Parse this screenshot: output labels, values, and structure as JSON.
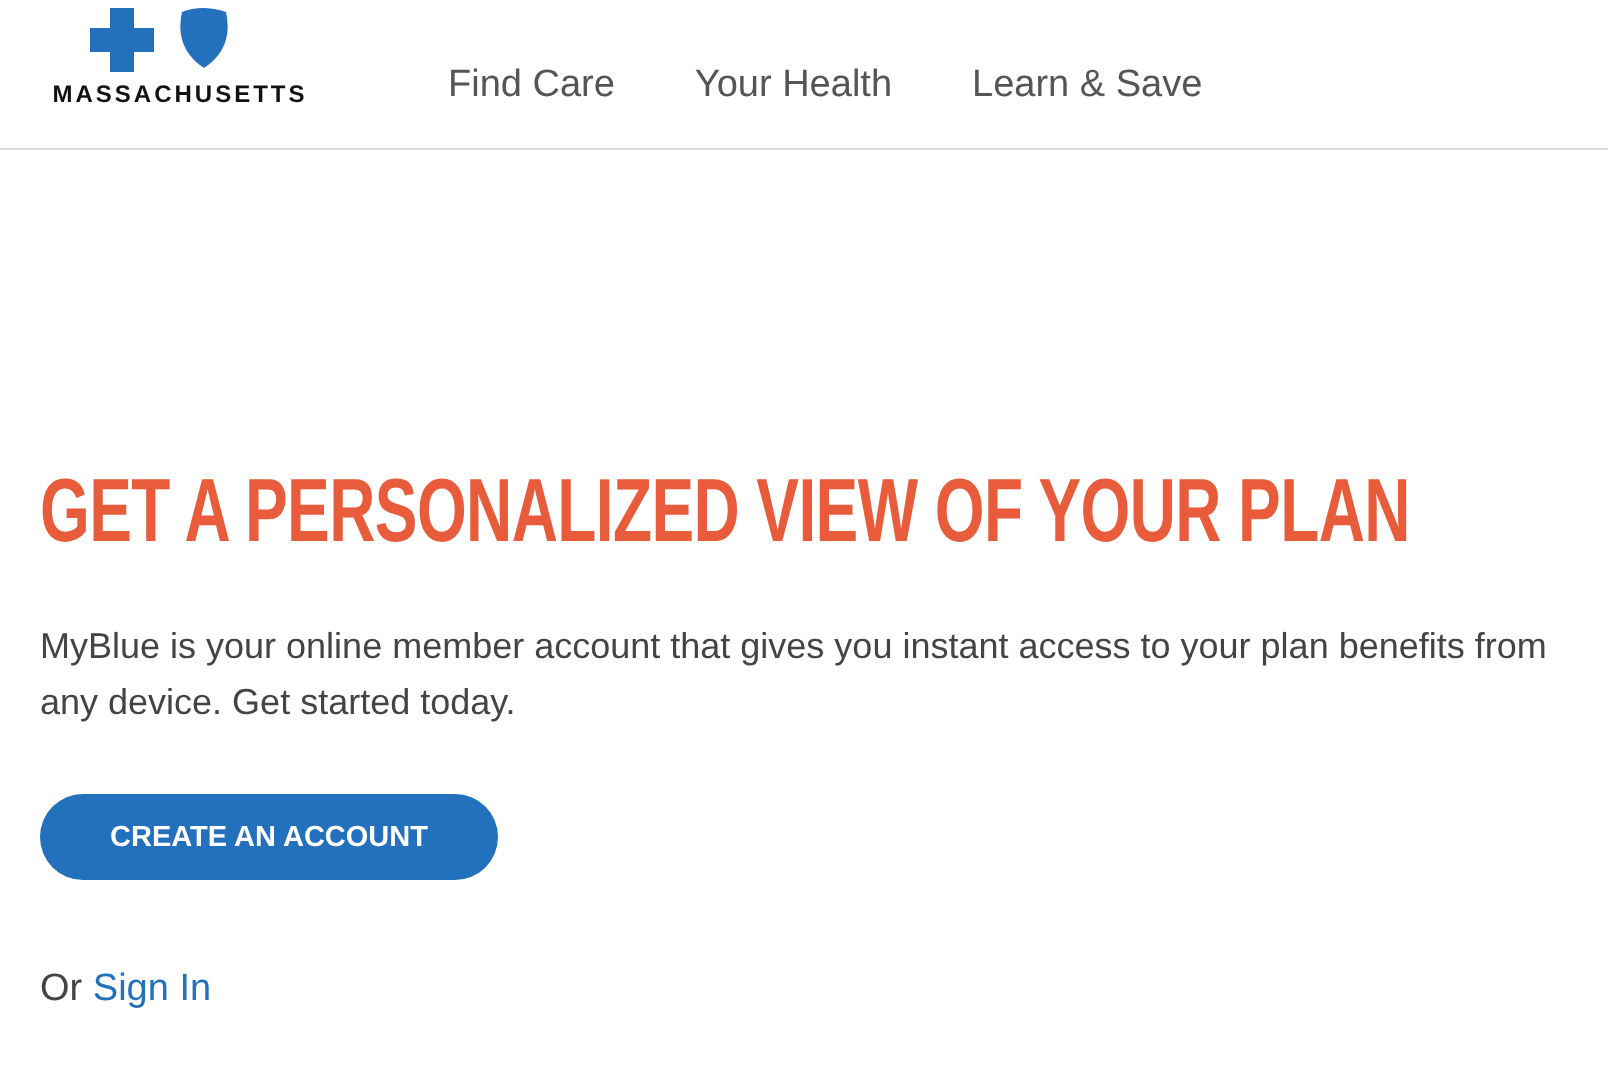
{
  "header": {
    "logo_text": "MASSACHUSETTS",
    "nav": [
      {
        "label": "Find Care"
      },
      {
        "label": "Your Health"
      },
      {
        "label": "Learn & Save"
      }
    ]
  },
  "hero": {
    "title": "GET A PERSONALIZED VIEW OF YOUR PLAN",
    "description": "MyBlue is your online member account that gives you instant access to your plan benefits from any device. Get started today.",
    "button": "CREATE AN ACCOUNT",
    "sign_in_prefix": "Or",
    "sign_in_link": "Sign In"
  }
}
